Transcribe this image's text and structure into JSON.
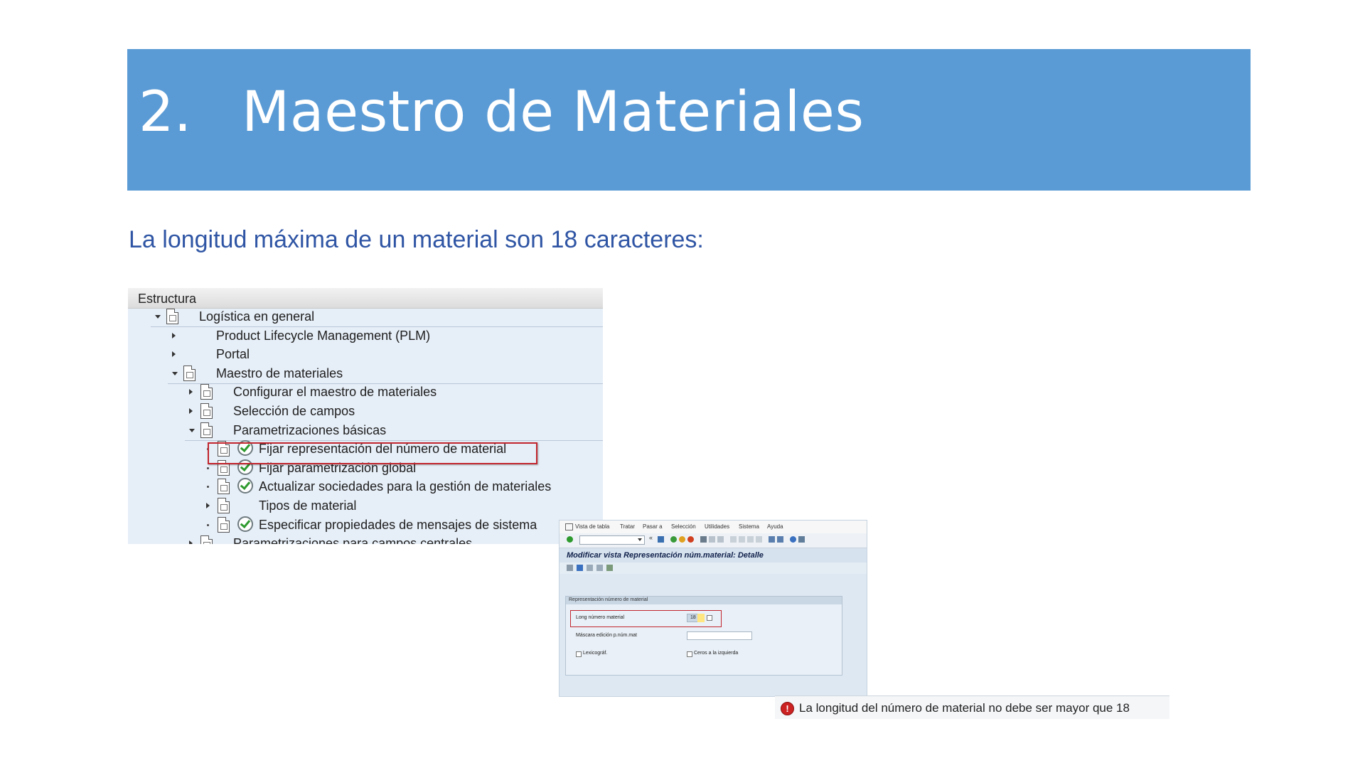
{
  "slide": {
    "number": "2.",
    "title": "Maestro de Materiales",
    "subtitle": "La longitud máxima de un material son 18 caracteres:"
  },
  "tree": {
    "header": "Estructura",
    "rows": [
      {
        "label": "Logística en general",
        "level": 0,
        "expander": "down",
        "doc_icon": true,
        "exec_icon": false
      },
      {
        "label": "Product Lifecycle Management (PLM)",
        "level": 1,
        "expander": "right",
        "doc_icon": false,
        "exec_icon": false
      },
      {
        "label": "Portal",
        "level": 1,
        "expander": "right",
        "doc_icon": false,
        "exec_icon": false
      },
      {
        "label": "Maestro de materiales",
        "level": 1,
        "expander": "down",
        "doc_icon": true,
        "exec_icon": false
      },
      {
        "label": "Configurar el maestro de materiales",
        "level": 2,
        "expander": "right",
        "doc_icon": true,
        "exec_icon": false
      },
      {
        "label": "Selección de campos",
        "level": 2,
        "expander": "right",
        "doc_icon": true,
        "exec_icon": false
      },
      {
        "label": "Parametrizaciones básicas",
        "level": 2,
        "expander": "down",
        "doc_icon": true,
        "exec_icon": false
      },
      {
        "label": "Fijar representación del número de material",
        "level": 3,
        "expander": "bullet",
        "doc_icon": true,
        "exec_icon": true,
        "highlighted": true
      },
      {
        "label": "Fijar parametrización global",
        "level": 3,
        "expander": "bullet",
        "doc_icon": true,
        "exec_icon": true
      },
      {
        "label": "Actualizar sociedades para la gestión de materiales",
        "level": 3,
        "expander": "bullet",
        "doc_icon": true,
        "exec_icon": true
      },
      {
        "label": "Tipos de material",
        "level": 3,
        "expander": "right",
        "doc_icon": true,
        "exec_icon": false
      },
      {
        "label": "Especificar propiedades de mensajes de sistema",
        "level": 3,
        "expander": "bullet",
        "doc_icon": true,
        "exec_icon": true
      },
      {
        "label": "Parametrizaciones para campos centrales",
        "level": 2,
        "expander": "right",
        "doc_icon": true,
        "exec_icon": false
      }
    ]
  },
  "sap_window": {
    "menu": [
      "Vista de tabla",
      "Tratar",
      "Pasar a",
      "Selección",
      "Utilidades",
      "Sistema",
      "Ayuda"
    ],
    "title": "Modificar vista Representación núm.material: Detalle",
    "group_title": "Representación número de material",
    "fields": {
      "length_label": "Long número material",
      "length_value": "18",
      "mask_label": "Máscara edición p.núm.mat",
      "lexico_label": "Lexicográf.",
      "zeros_label": "Ceros a la izquierda"
    }
  },
  "status_bar": {
    "icon": "error-icon",
    "message": "La longitud del número de material no debe ser mayor que 18"
  },
  "colors": {
    "banner": "#5b9bd5",
    "subtitle": "#2f55a4",
    "highlight": "#c2262e"
  }
}
